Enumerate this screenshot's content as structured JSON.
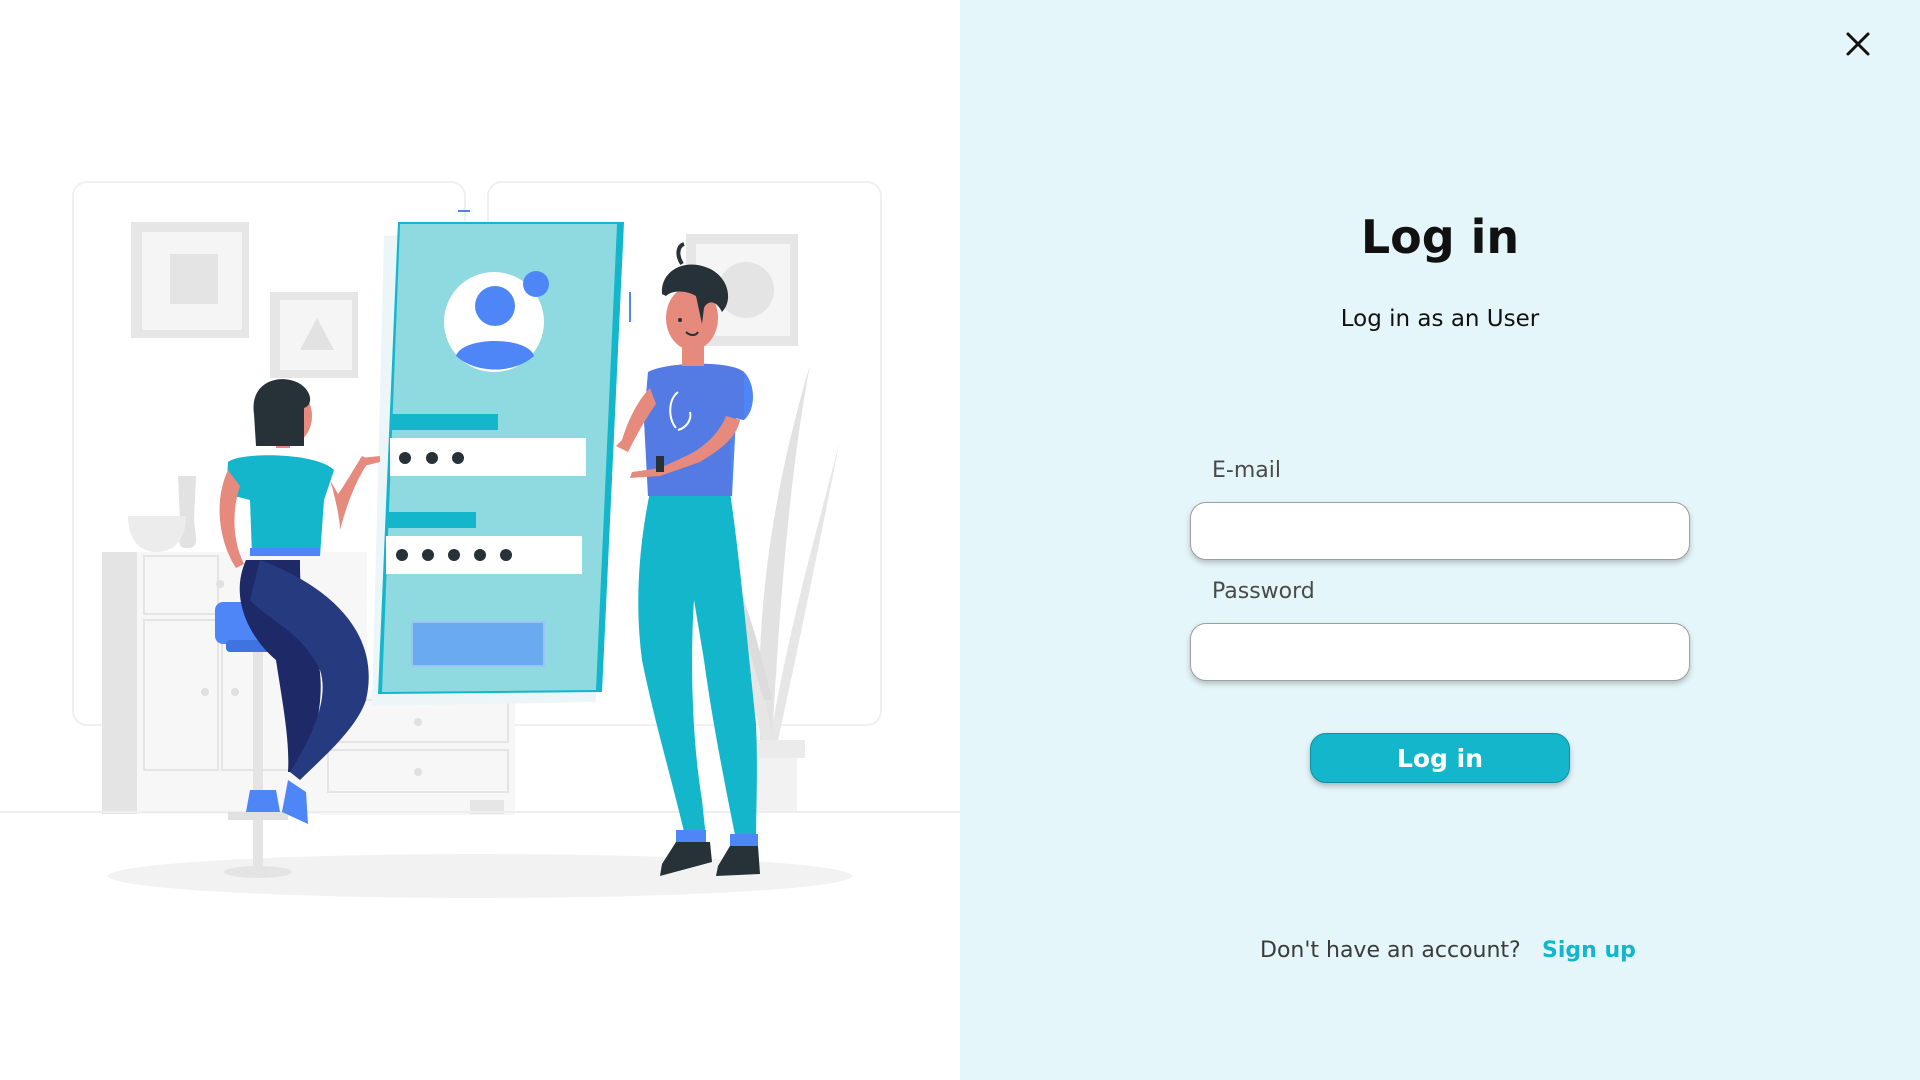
{
  "illustration": {
    "name": "login-illustration",
    "screen_password_dots": 3,
    "screen_password_dots_2": 5
  },
  "close_icon": "close-icon",
  "login": {
    "title": "Log in",
    "subtitle": "Log in as an User",
    "email_label": "E-mail",
    "email_value": "",
    "password_label": "Password",
    "password_value": "",
    "button_label": "Log in",
    "signup_prompt": "Don't have an account?",
    "signup_link": "Sign up"
  },
  "colors": {
    "accent": "#13b6cb",
    "panel_background": "#e4f6f9",
    "blue": "#4f86f7",
    "navy": "#1e2a68"
  }
}
